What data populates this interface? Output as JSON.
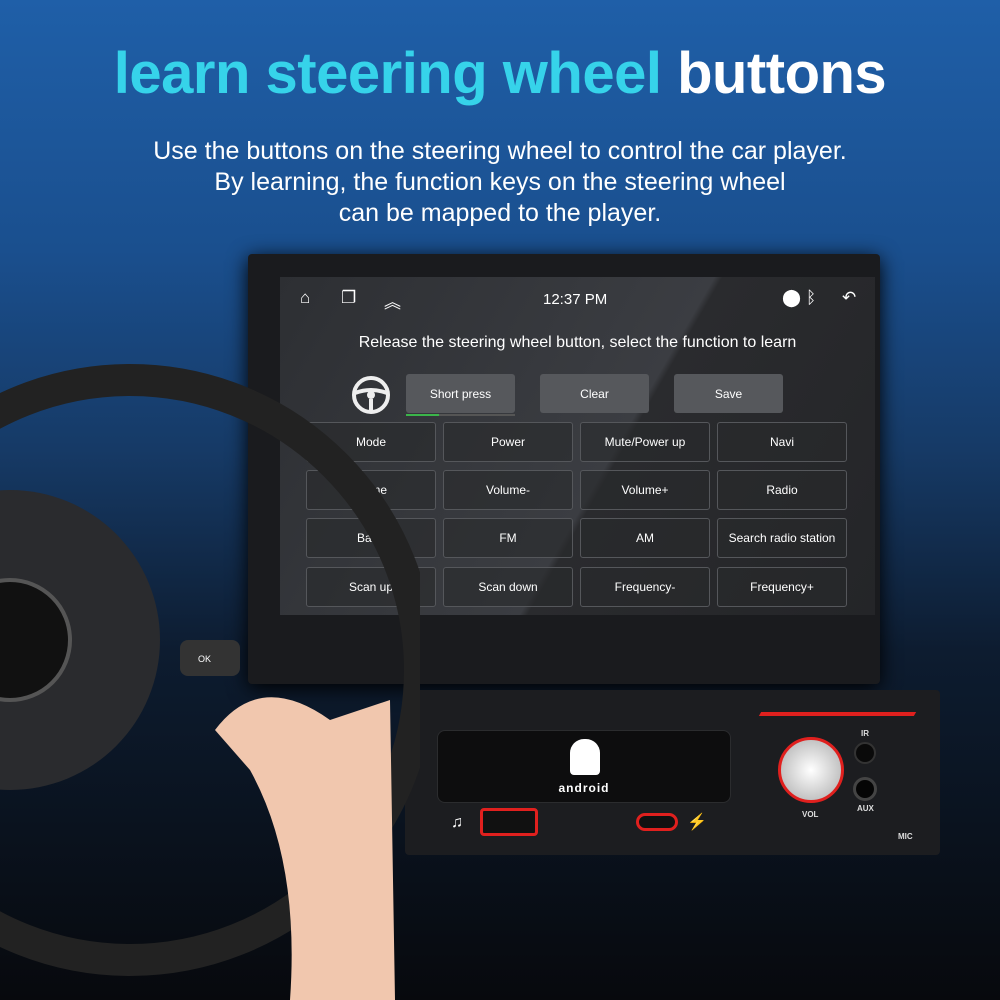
{
  "headline": {
    "highlight": "learn steering wheel",
    "rest": "buttons"
  },
  "description": [
    "Use the buttons on the steering wheel to control the car player.",
    "By learning, the function keys on the steering wheel",
    "can be mapped to the player."
  ],
  "status_bar": {
    "time": "12:37 PM",
    "icons": [
      "home-icon",
      "recent-apps-icon",
      "expand-up-icon",
      "location-icon",
      "bluetooth-icon",
      "back-icon"
    ]
  },
  "screen": {
    "prompt": "Release the steering wheel button, select the function to learn",
    "actions": [
      "Short press",
      "Clear",
      "Save"
    ],
    "press_progress": 0.3,
    "functions": [
      [
        "Mode",
        "Power",
        "Mute/Power up",
        "Navi"
      ],
      [
        "Home",
        "Volume-",
        "Volume+",
        "Radio"
      ],
      [
        "Band",
        "FM",
        "AM",
        "Search radio station"
      ],
      [
        "Scan up",
        "Scan down",
        "Frequency-",
        "Frequency+"
      ]
    ]
  },
  "panel": {
    "logo": "android",
    "labels": {
      "ir": "IR",
      "vol": "VOL",
      "aux": "AUX",
      "mic": "MIC"
    }
  },
  "wheel": {
    "ok": "OK"
  },
  "colors": {
    "accent": "#36d3ea",
    "red": "#e0201e"
  }
}
